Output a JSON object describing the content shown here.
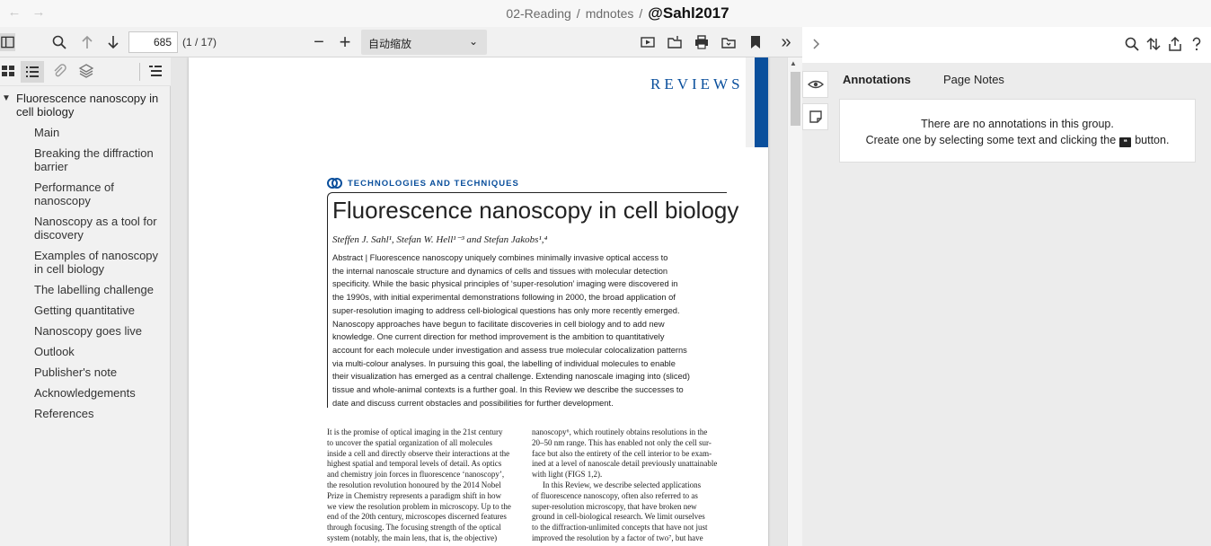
{
  "titlebar": {
    "back_icon": "arrow-left-icon",
    "forward_icon": "arrow-right-icon",
    "crumbs": [
      "02-Reading",
      "mdnotes"
    ],
    "current": "@Sahl2017",
    "separator": "/"
  },
  "toolbar": {
    "page_value": "685",
    "page_count": "(1 / 17)",
    "zoom_minus": "−",
    "zoom_plus": "+",
    "zoom_label": "自动缩放",
    "more": "»"
  },
  "sidebar": {
    "toggle": "▼",
    "outline_root": "Fluorescence nanoscopy in cell biology",
    "items": [
      {
        "label": "Main"
      },
      {
        "label": "Breaking the diffraction barrier"
      },
      {
        "label": "Performance of nanoscopy"
      },
      {
        "label": "Nanoscopy as a tool for discovery"
      },
      {
        "label": "Examples of nanoscopy in cell biology"
      },
      {
        "label": "The labelling challenge"
      },
      {
        "label": "Getting quantitative"
      },
      {
        "label": "Nanoscopy goes live"
      },
      {
        "label": "Outlook"
      },
      {
        "label": "Publisher's note"
      },
      {
        "label": "Acknowledgements"
      },
      {
        "label": "References"
      }
    ]
  },
  "document": {
    "journal_section": "REVIEWS",
    "category": "TECHNOLOGIES AND TECHNIQUES",
    "title": "Fluorescence nanoscopy in cell biology",
    "authors": "Steffen J. Sahl¹, Stefan W. Hell¹⁻³ and Stefan Jakobs¹,⁴",
    "abstract_lines": [
      "Abstract | Fluorescence nanoscopy uniquely combines minimally invasive optical access to",
      "the internal nanoscale structure and dynamics of cells and tissues with molecular detection",
      "specificity. While the basic physical principles of ‘super-resolution’ imaging were discovered in",
      "the 1990s, with initial experimental demonstrations following in 2000, the broad application of",
      "super-resolution imaging to address cell-biological questions has only more recently emerged.",
      "Nanoscopy approaches have begun to facilitate discoveries in cell biology and to add new",
      "knowledge. One current direction for method improvement is the ambition to quantitatively",
      "account for each molecule under investigation and assess true molecular colocalization patterns",
      "via multi-colour analyses. In pursuing this goal, the labelling of individual molecules to enable",
      "their visualization has emerged as a central challenge. Extending nanoscale imaging into (sliced)",
      "tissue and whole-animal contexts is a further goal. In this Review we describe the successes to",
      "date and discuss current obstacles and possibilities for further development."
    ],
    "body_left": [
      "It is the promise of optical imaging in the 21st century",
      "to uncover the spatial organization of all molecules",
      "inside a cell and directly observe their interactions at the",
      "highest spatial and temporal levels of detail. As optics",
      "and chemistry join forces in fluorescence ‘nanoscopy’,",
      "the resolution revolution honoured by the 2014 Nobel",
      "Prize in Chemistry represents a paradigm shift in how",
      "we view the resolution problem in microscopy. Up to the",
      "end of the 20th century, microscopes discerned features",
      "through focusing. The focusing strength of the optical",
      "system (notably, the main lens, that is, the objective)"
    ],
    "body_right": [
      "nanoscopy⁶, which routinely obtains resolutions in the",
      "20–50 nm range. This has enabled not only the cell sur-",
      "face but also the entirety of the cell interior to be exam-",
      "ined at a level of nanoscale detail previously unattainable",
      "with light (FIGS 1,2).",
      "In this Review, we describe selected applications",
      "of fluorescence nanoscopy, often also referred to as",
      "super-resolution microscopy, that have broken new",
      "ground in cell-biological research. We limit ourselves",
      "to the diffraction-unlimited concepts that have not just",
      "improved the resolution by a factor of two⁷, but have"
    ]
  },
  "annotations": {
    "tabs": [
      "Annotations",
      "Page Notes"
    ],
    "empty_line1": "There are no annotations in this group.",
    "empty_line2a": "Create one by selecting some text and clicking the",
    "empty_line2b": "button.",
    "button_glyph": "❝"
  },
  "colors": {
    "accent_blue": "#0a4f9c",
    "sidebar_bg": "#f1f1f1",
    "panel_bg": "#ececec"
  }
}
